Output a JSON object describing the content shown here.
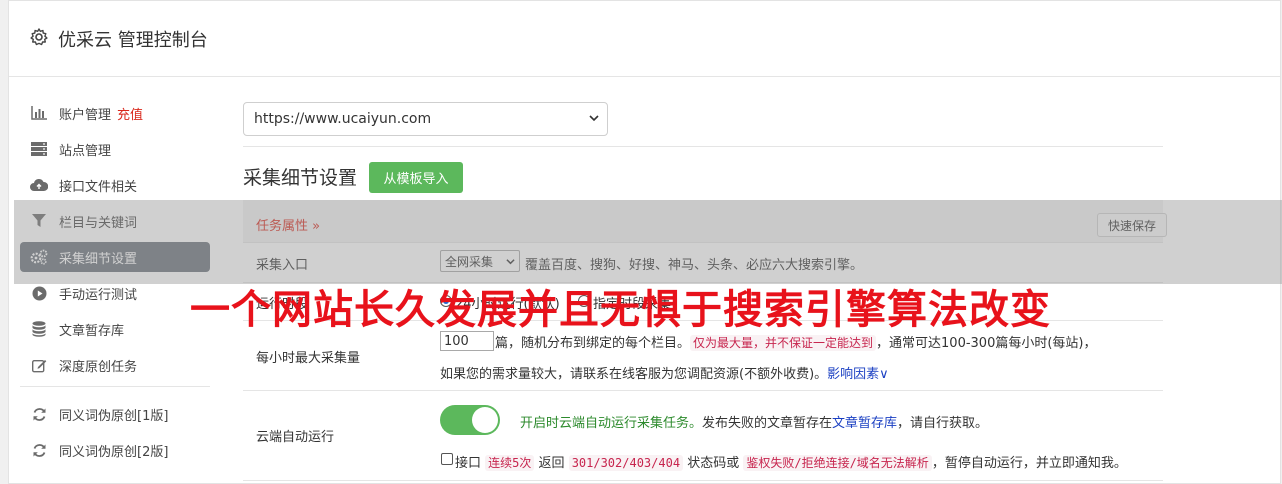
{
  "header": {
    "title": "优采云 管理控制台",
    "icon": "gear-icon"
  },
  "sidebar": {
    "items": [
      {
        "label": "账户管理",
        "tag": "充值",
        "icon": "bar-chart-icon"
      },
      {
        "label": "站点管理",
        "icon": "server-icon"
      },
      {
        "label": "接口文件相关",
        "icon": "cloud-upload-icon"
      },
      {
        "label": "栏目与关键词",
        "icon": "filter-icon"
      },
      {
        "label": "采集细节设置",
        "icon": "gears-icon",
        "active": true
      },
      {
        "label": "手动运行测试",
        "icon": "play-circle-icon"
      },
      {
        "label": "文章暂存库",
        "icon": "database-icon"
      },
      {
        "label": "深度原创任务",
        "icon": "edit-icon"
      }
    ],
    "items2": [
      {
        "label": "同义词伪原创[1版]",
        "icon": "refresh-icon"
      },
      {
        "label": "同义词伪原创[2版]",
        "icon": "refresh-icon"
      }
    ]
  },
  "main": {
    "site_select_value": "https://www.ucaiyun.com",
    "section_title": "采集细节设置",
    "import_button": "从模板导入",
    "task_attr_label": "任务属性",
    "quick_save": "快速保存",
    "entry": {
      "label": "采集入口",
      "select_value": "全网采集",
      "desc": "覆盖百度、搜狗、好搜、神马、头条、必应六大搜索引擎。"
    },
    "run_time": {
      "label": "运行时段",
      "option1": "24小时运行(默认)",
      "option2": "指定时段采集"
    },
    "max_per_hour": {
      "label": "每小时最大采集量",
      "value": "100",
      "text1": "篇，随机分布到绑定的每个栏目。",
      "code1": "仅为最大量，并不保证一定能达到",
      "text2": "，通常可达100-300篇每小时(每站)，",
      "text3": "如果您的需求量较大，请联系在线客服为您调配资源(不额外收费)。",
      "link": "影响因素"
    },
    "cloud_run": {
      "label": "云端自动运行",
      "green_text": "开启时云端自动运行采集任务。",
      "text1": "发布失败的文章暂存在",
      "link": "文章暂存库",
      "text2": "，请自行获取。",
      "cb_text1": "接口",
      "code1": "连续5次",
      "cb_text2": "返回",
      "code2": "301/302/403/404",
      "cb_text3": "状态码或",
      "code3": "鉴权失败/拒绝连接/域名无法解析",
      "cb_text4": "，暂停自动运行，并立即通知我。"
    }
  },
  "watermark": "一个网站长久发展并且无惧于搜索引擎算法改变",
  "colors": {
    "active_sidebar": "#6a717a",
    "green": "#5cb85c",
    "red": "#d9281c",
    "link": "#1a3fc2"
  }
}
